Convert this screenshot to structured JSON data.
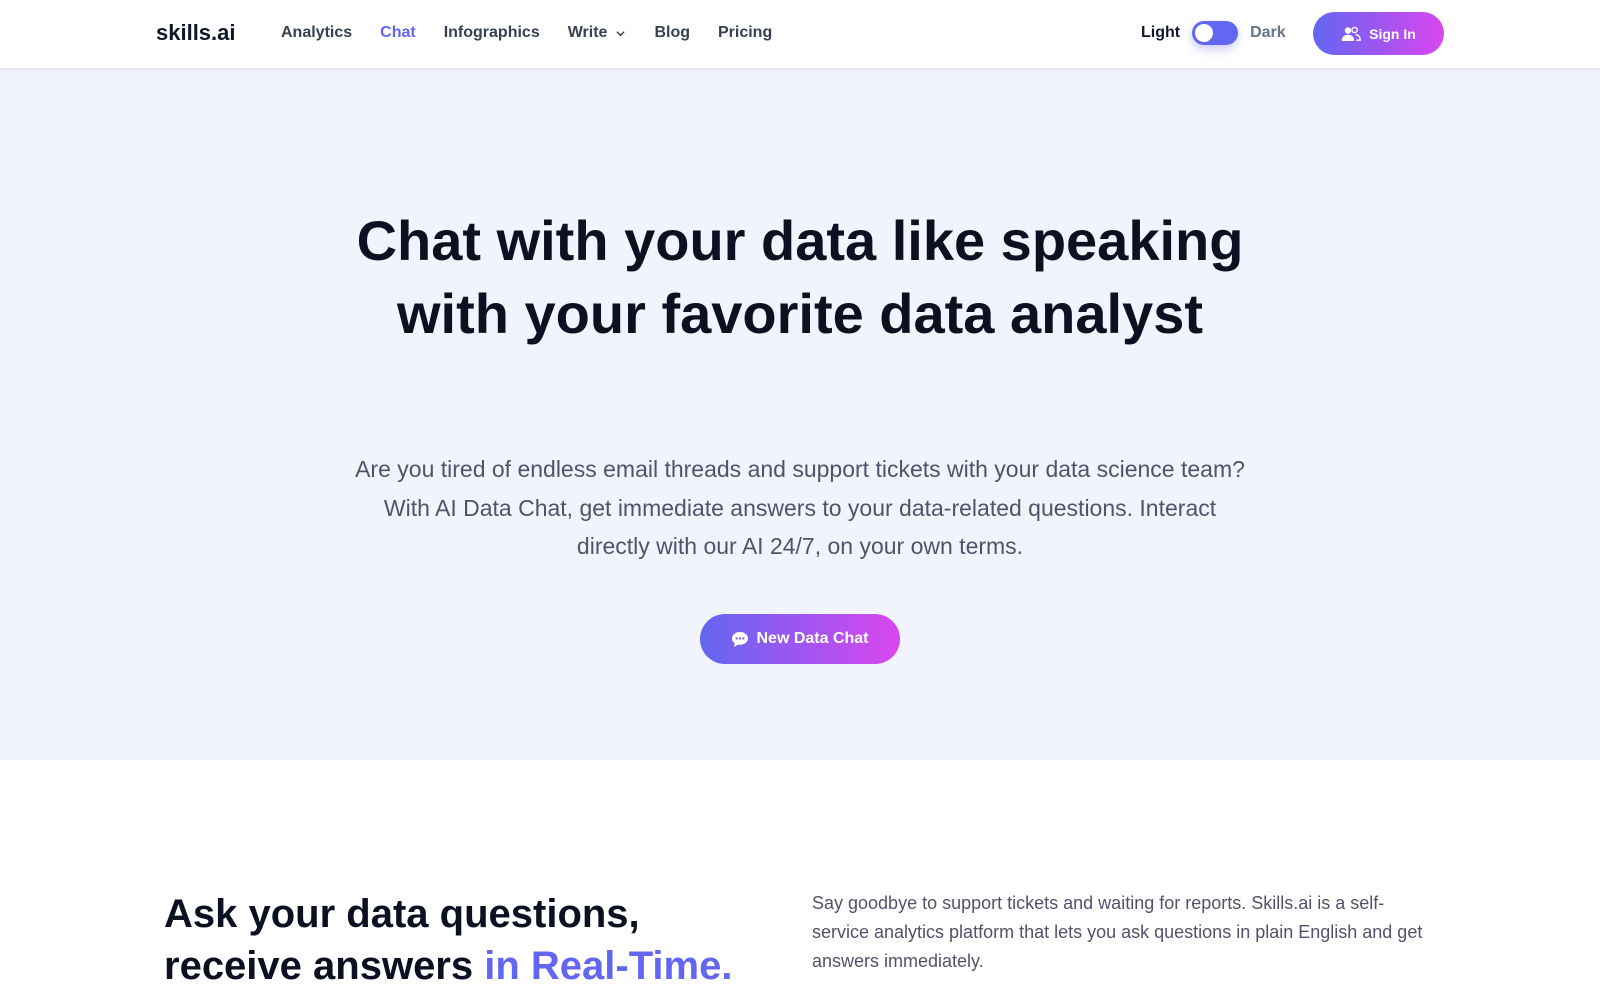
{
  "header": {
    "logo": "skills.ai",
    "nav": [
      {
        "label": "Analytics",
        "active": false
      },
      {
        "label": "Chat",
        "active": true
      },
      {
        "label": "Infographics",
        "active": false
      },
      {
        "label": "Write",
        "active": false,
        "dropdown": true
      },
      {
        "label": "Blog",
        "active": false
      },
      {
        "label": "Pricing",
        "active": false
      }
    ],
    "theme": {
      "light_label": "Light",
      "dark_label": "Dark",
      "state": "light"
    },
    "signin_label": "Sign In"
  },
  "hero": {
    "title": "Chat with your data like speaking with your favorite data analyst",
    "subtitle": "Are you tired of endless email threads and support tickets with your data science team? With AI Data Chat, get immediate answers to your data-related questions. Interact directly with our AI 24/7, on your own terms.",
    "cta_label": "New Data Chat"
  },
  "feature": {
    "title_main": "Ask your data questions, receive answers",
    "title_accent": "in Real-Time.",
    "text": "Say goodbye to support tickets and waiting for reports. Skills.ai is a self-service analytics platform that lets you ask questions in plain English and get answers immediately."
  },
  "colors": {
    "accent": "#6366f1",
    "gradient_end": "#d946ef",
    "hero_bg": "#f1f4fc"
  },
  "icons": {
    "signin": "users-icon",
    "cta": "chat-bubble-icon",
    "dropdown": "chevron-down-icon"
  }
}
